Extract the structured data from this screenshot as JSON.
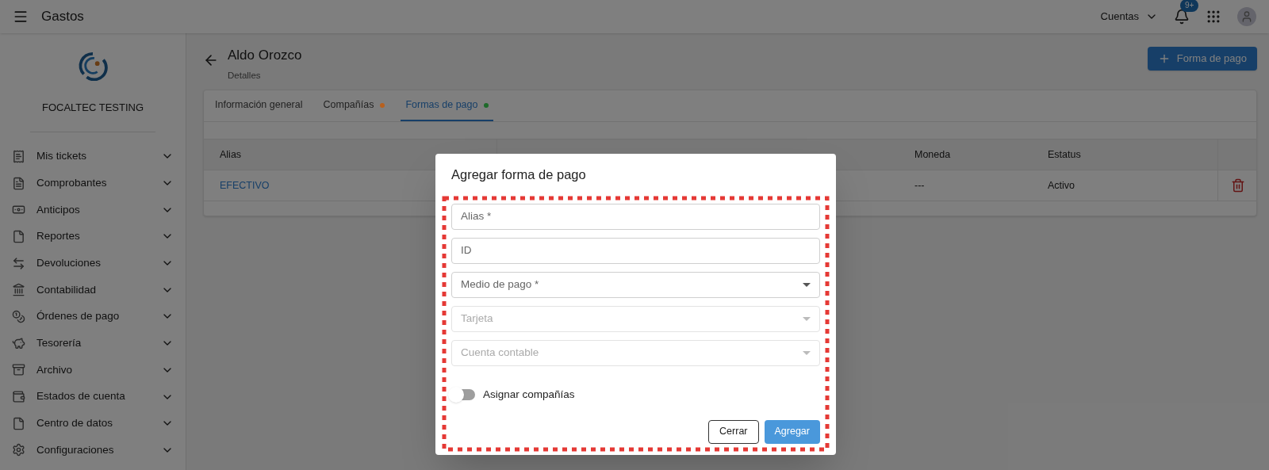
{
  "top_bar": {
    "title": "Gastos",
    "account_menu": "Cuentas",
    "notification_badge": "9+"
  },
  "sidebar": {
    "company": "FOCALTEC TESTING",
    "items": [
      {
        "label": "Mis tickets"
      },
      {
        "label": "Comprobantes"
      },
      {
        "label": "Anticipos"
      },
      {
        "label": "Reportes"
      },
      {
        "label": "Devoluciones"
      },
      {
        "label": "Contabilidad"
      },
      {
        "label": "Órdenes de pago"
      },
      {
        "label": "Tesorería"
      },
      {
        "label": "Archivo"
      },
      {
        "label": "Estados de cuenta"
      },
      {
        "label": "Centro de datos"
      },
      {
        "label": "Configuraciones"
      }
    ]
  },
  "header": {
    "title": "Aldo Orozco",
    "subtitle": "Detalles",
    "add_button": "Forma de pago"
  },
  "tabs": [
    {
      "label": "Información general",
      "selected": false
    },
    {
      "label": "Compañías",
      "selected": false,
      "color": "#b8601e"
    },
    {
      "label": "Formas de pago",
      "selected": true,
      "color": "#1e6a2a"
    }
  ],
  "table": {
    "columns": [
      "Alias",
      "Moneda",
      "Estatus"
    ],
    "rows": [
      {
        "alias": "EFECTIVO",
        "moneda": "---",
        "estatus": "Activo"
      }
    ]
  },
  "dialog": {
    "title": "Agregar forma de pago",
    "fields": [
      {
        "kind": "text",
        "placeholder": "Alias *",
        "disabled": false
      },
      {
        "kind": "text",
        "placeholder": "ID",
        "disabled": false
      },
      {
        "kind": "select",
        "placeholder": "Medio de pago *",
        "disabled": false
      },
      {
        "kind": "select",
        "placeholder": "Tarjeta",
        "disabled": true
      },
      {
        "kind": "select",
        "placeholder": "Cuenta contable",
        "disabled": true
      }
    ],
    "toggle": {
      "label": "Asignar compañías",
      "on": false
    },
    "buttons": [
      {
        "kind": "secondary",
        "label": "Cerrar"
      },
      {
        "kind": "primary",
        "label": "Agregar"
      }
    ]
  }
}
